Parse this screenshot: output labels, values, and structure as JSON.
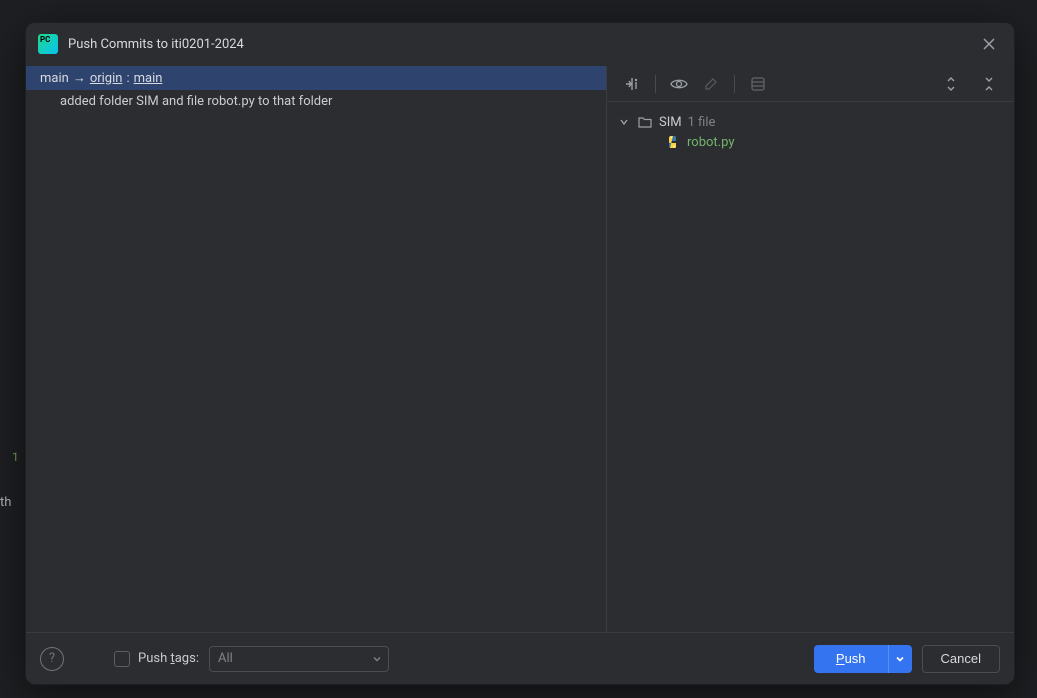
{
  "bg": {
    "lineno": "1",
    "snippet": "th"
  },
  "dialog": {
    "title": "Push Commits to iti0201-2024",
    "branches": {
      "local": "main",
      "remote": "origin",
      "target": "main"
    },
    "commits": [
      {
        "message": "added folder SIM and file robot.py to that folder"
      }
    ],
    "files": {
      "folder": "SIM",
      "count": "1 file",
      "items": [
        {
          "name": "robot.py"
        }
      ]
    },
    "footer": {
      "push_tags_label": "Push tags:",
      "push_tags_option": "All",
      "push_label": "Push",
      "cancel_label": "Cancel"
    }
  }
}
